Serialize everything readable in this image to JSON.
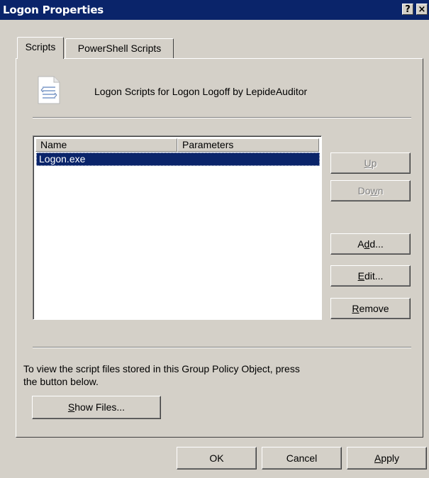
{
  "window": {
    "title": "Logon Properties",
    "help_glyph": "?",
    "close_glyph": "×"
  },
  "tabs": [
    {
      "label": "Scripts",
      "active": true
    },
    {
      "label": "PowerShell Scripts",
      "active": false
    }
  ],
  "header": {
    "icon": "script-document-icon",
    "text": "Logon Scripts for Logon Logoff by LepideAuditor"
  },
  "list": {
    "columns": [
      "Name",
      "Parameters"
    ],
    "rows": [
      {
        "name": "Logon.exe",
        "parameters": "",
        "selected": true
      }
    ]
  },
  "side_buttons": {
    "up": {
      "pre": "",
      "ul": "U",
      "post": "p",
      "enabled": false
    },
    "down": {
      "pre": "Do",
      "ul": "w",
      "post": "n",
      "enabled": false
    },
    "add": {
      "pre": "A",
      "ul": "d",
      "post": "d...",
      "enabled": true
    },
    "edit": {
      "pre": "",
      "ul": "E",
      "post": "dit...",
      "enabled": true
    },
    "remove": {
      "pre": "",
      "ul": "R",
      "post": "emove",
      "enabled": true
    }
  },
  "info": {
    "line1": "To view the script files stored in this Group Policy Object, press",
    "line2": "the button below."
  },
  "show_files": {
    "pre": "",
    "ul": "S",
    "post": "how Files..."
  },
  "footer": {
    "ok": "OK",
    "cancel": "Cancel",
    "apply": {
      "pre": "",
      "ul": "A",
      "post": "pply"
    }
  },
  "colors": {
    "titlebar": "#0a246a",
    "face": "#d4d0c8",
    "selection": "#0a246a"
  }
}
